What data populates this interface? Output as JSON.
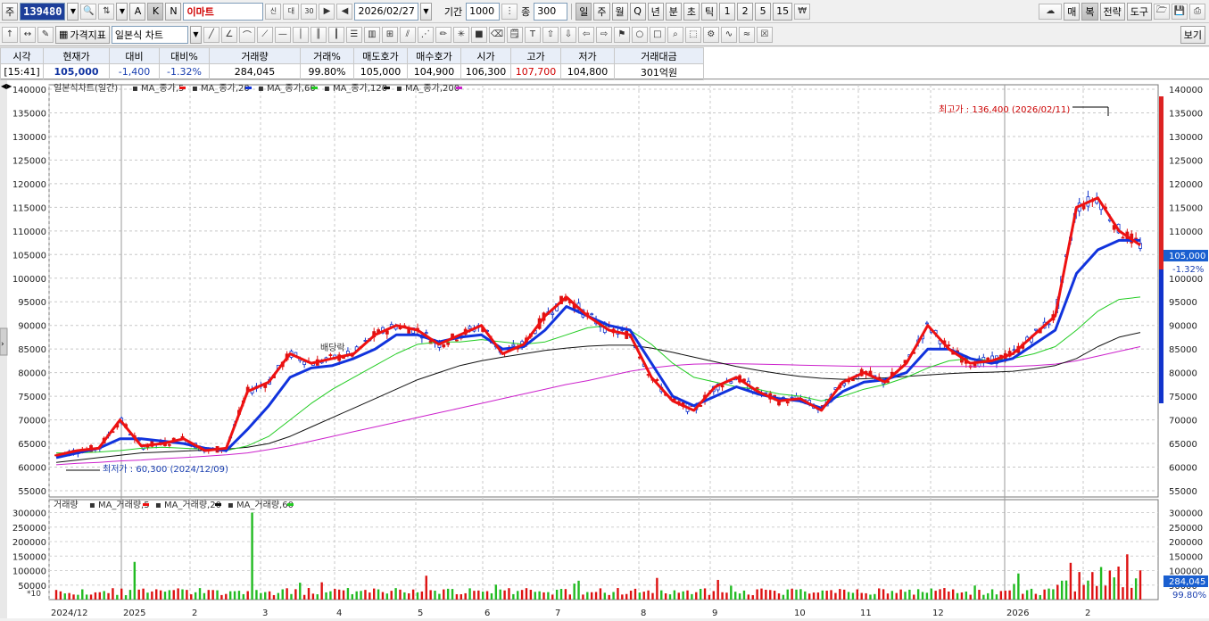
{
  "toolbar1": {
    "type_label": "주",
    "code": "139480",
    "btn_a": "A",
    "btn_k": "K",
    "btn_n": "N",
    "name": "이마트",
    "date": "2026/02/27",
    "period_label": "기간",
    "period_value": "1000",
    "count_label": "종",
    "count_value": "300",
    "intervals": [
      "일",
      "주",
      "월",
      "Q",
      "년",
      "분",
      "초",
      "틱",
      "1",
      "2",
      "5",
      "15"
    ],
    "right_buttons": [
      "매",
      "복",
      "전략",
      "도구"
    ]
  },
  "toolbar2": {
    "indicator_label": "가격지표",
    "chart_type": "일본식 차트",
    "view_label": "보기"
  },
  "quote": {
    "headers": [
      "시각",
      "현재가",
      "대비",
      "대비%",
      "거래량",
      "거래%",
      "매도호가",
      "매수호가",
      "시가",
      "고가",
      "저가",
      "거래대금"
    ],
    "values": [
      "[15:41]",
      "105,000",
      "-1,400",
      "-1.32%",
      "284,045",
      "99.80%",
      "105,000",
      "104,900",
      "106,300",
      "107,700",
      "104,800",
      "301억원"
    ]
  },
  "price_panel": {
    "legend_title": "일본식차트(일간)",
    "ma_labels": [
      "MA_종가,5",
      "MA_종가,20",
      "MA_종가,60",
      "MA_종가,120",
      "MA_종가,200"
    ],
    "ma_colors": [
      "#ee1111",
      "#1133dd",
      "#22cc22",
      "#111111",
      "#cc22cc"
    ],
    "max_note": "최고가 : 136,400 (2026/02/11)",
    "min_note": "최저가 : 60,300 (2024/12/09)",
    "dividend_note": "배당락",
    "current_price_tag": "105,000",
    "current_change_tag": "-1.32%"
  },
  "volume_panel": {
    "legend_title": "거래량",
    "ma_labels": [
      "MA_거래량,5",
      "MA_거래량,20",
      "MA_거래량,60"
    ],
    "ma_colors": [
      "#ee1111",
      "#111111",
      "#22cc22"
    ],
    "unit_note": "*10",
    "current_volume_tag": "284,045",
    "current_ratio_tag": "99.80%"
  },
  "x_labels": [
    "2024/12",
    "2025",
    "2",
    "3",
    "4",
    "5",
    "6",
    "7",
    "8",
    "9",
    "10",
    "11",
    "12",
    "2026",
    "2"
  ],
  "price_y_labels": [
    "140000",
    "135000",
    "130000",
    "125000",
    "120000",
    "115000",
    "110000",
    "105000",
    "100000",
    "95000",
    "90000",
    "85000",
    "80000",
    "75000",
    "70000",
    "65000",
    "60000",
    "55000"
  ],
  "volume_y_labels": [
    "300000",
    "250000",
    "200000",
    "150000",
    "100000",
    "50000"
  ],
  "chart_data": {
    "type": "candlestick",
    "price_ylim": [
      55000,
      140000
    ],
    "volume_ylim": [
      0,
      320000
    ],
    "x": [
      "2024/12",
      "2025",
      "2",
      "3",
      "4",
      "5",
      "6",
      "7",
      "8",
      "9",
      "10",
      "11",
      "12",
      "2026",
      "2"
    ],
    "series": [
      {
        "name": "MA_종가,5",
        "values": [
          62500,
          63500,
          64000,
          70000,
          64500,
          65000,
          66000,
          63500,
          64000,
          76000,
          78000,
          84000,
          82000,
          83000,
          84000,
          88000,
          90000,
          89000,
          86000,
          88000,
          90000,
          84000,
          86000,
          92000,
          96000,
          92000,
          89000,
          88000,
          79000,
          74000,
          72000,
          77000,
          79000,
          76000,
          74000,
          74500,
          72000,
          78000,
          80000,
          78000,
          82000,
          90000,
          85000,
          82000,
          82500,
          84000,
          88000,
          92000,
          115000,
          117000,
          110000,
          107000
        ]
      },
      {
        "name": "MA_종가,20",
        "values": [
          62000,
          63000,
          64000,
          66000,
          66000,
          65500,
          65000,
          64000,
          63500,
          68000,
          73000,
          79000,
          81000,
          81500,
          83000,
          85000,
          88000,
          88000,
          86500,
          87500,
          88000,
          85000,
          85500,
          89000,
          94000,
          92000,
          90000,
          89000,
          82000,
          75000,
          73000,
          75000,
          77000,
          75500,
          74500,
          74000,
          72500,
          76000,
          78000,
          78500,
          80000,
          85000,
          85000,
          83000,
          82000,
          83000,
          86000,
          89000,
          101000,
          106000,
          108000,
          108000
        ]
      },
      {
        "name": "MA_종가,60",
        "values": [
          63000,
          63000,
          63200,
          63500,
          64000,
          64200,
          64000,
          63800,
          63500,
          64500,
          66500,
          70000,
          73500,
          76500,
          79000,
          81500,
          84000,
          86000,
          86500,
          86500,
          87000,
          86500,
          86000,
          86500,
          88000,
          89500,
          90000,
          89000,
          86000,
          82000,
          79000,
          78000,
          77000,
          76500,
          75500,
          75000,
          74000,
          75000,
          76500,
          77500,
          79000,
          81000,
          82500,
          83000,
          82500,
          83000,
          84000,
          85500,
          89000,
          93000,
          95500,
          96000
        ]
      },
      {
        "name": "MA_종가,120",
        "values": [
          61000,
          61500,
          62000,
          62500,
          63000,
          63200,
          63400,
          63600,
          63800,
          64200,
          65000,
          66500,
          68500,
          70500,
          72500,
          74500,
          76500,
          78500,
          80000,
          81500,
          82500,
          83300,
          84000,
          84700,
          85200,
          85600,
          85800,
          85800,
          85200,
          84300,
          83300,
          82300,
          81300,
          80500,
          79800,
          79200,
          78800,
          78600,
          78700,
          78900,
          79200,
          79500,
          79800,
          80000,
          80100,
          80300,
          80800,
          81500,
          83000,
          85500,
          87500,
          88500
        ]
      },
      {
        "name": "MA_종가,200",
        "values": [
          60500,
          60800,
          61000,
          61300,
          61500,
          61800,
          62000,
          62300,
          62600,
          63000,
          63700,
          64500,
          65500,
          66500,
          67500,
          68500,
          69500,
          70500,
          71500,
          72500,
          73500,
          74500,
          75500,
          76500,
          77500,
          78300,
          79300,
          80300,
          81000,
          81500,
          81800,
          81900,
          81900,
          81800,
          81700,
          81600,
          81500,
          81400,
          81300,
          81300,
          81300,
          81300,
          81300,
          81300,
          81300,
          81300,
          81500,
          81800,
          82500,
          83500,
          84500,
          85500
        ]
      }
    ],
    "max_marker": {
      "label": "2026/02/11",
      "value": 136400
    },
    "min_marker": {
      "label": "2024/12/09",
      "value": 60300
    },
    "last": {
      "price": 105000,
      "volume": 284045
    }
  }
}
